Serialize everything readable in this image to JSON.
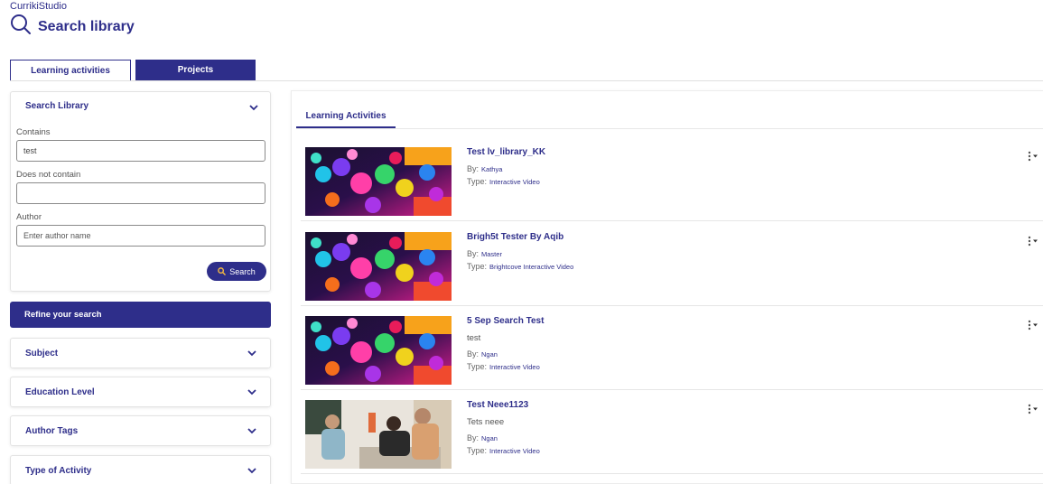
{
  "app": {
    "brand": "CurrikiStudio",
    "page_title": "Search library",
    "search_icon": "search-icon"
  },
  "top_tabs": [
    {
      "label": "Learning activities",
      "active": true
    },
    {
      "label": "Projects",
      "active": false
    }
  ],
  "search_panel": {
    "header": "Search Library",
    "contains_label": "Contains",
    "contains_value": "test",
    "not_contains_label": "Does not contain",
    "not_contains_value": "",
    "author_label": "Author",
    "author_placeholder": "Enter author name",
    "search_button": "Search"
  },
  "refine_label": "Refine your search",
  "filters": [
    {
      "label": "Subject"
    },
    {
      "label": "Education Level"
    },
    {
      "label": "Author Tags"
    },
    {
      "label": "Type of Activity"
    }
  ],
  "results_tab": "Learning Activities",
  "items": [
    {
      "title": "Test lv_library_KK",
      "description": "",
      "by_label": "By:",
      "by": "Kathya",
      "type_label": "Type:",
      "type": "Interactive Video",
      "thumb": "colorful-cells"
    },
    {
      "title": "Brigh5t Tester By Aqib",
      "description": "",
      "by_label": "By:",
      "by": "Master",
      "type_label": "Type:",
      "type": "Brightcove Interactive Video",
      "thumb": "colorful-cells"
    },
    {
      "title": "5 Sep Search Test",
      "description": "test",
      "by_label": "By:",
      "by": "Ngan",
      "type_label": "Type:",
      "type": "Interactive Video",
      "thumb": "colorful-cells"
    },
    {
      "title": "Test Neee1123",
      "description": "Tets neee",
      "by_label": "By:",
      "by": "Ngan",
      "type_label": "Type:",
      "type": "Interactive Video",
      "thumb": "office-people"
    }
  ],
  "colors": {
    "primary": "#2e2e8a",
    "border": "#e3e3e3"
  }
}
